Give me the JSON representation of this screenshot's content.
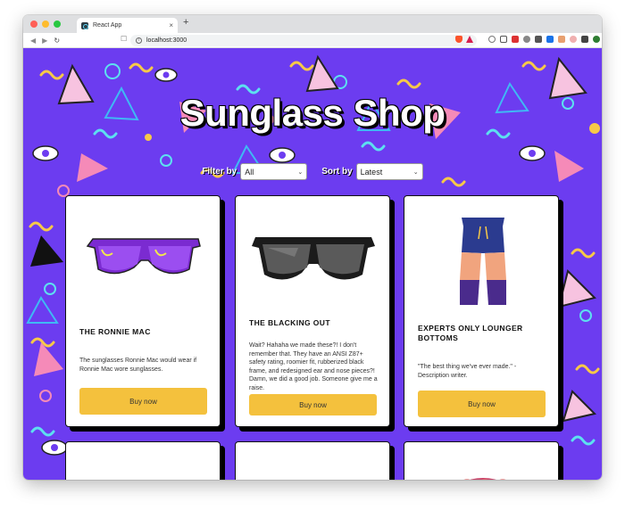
{
  "browser": {
    "tab_title": "React App",
    "tab_close": "×",
    "new_tab": "+",
    "url": "localhost:3000",
    "nav": {
      "back": "◀",
      "forward": "▶",
      "reload": "↻"
    },
    "traffic_lights": [
      "#ff5f57",
      "#febc2e",
      "#28c840"
    ]
  },
  "page": {
    "title": "Sunglass Shop",
    "filter": {
      "label": "Filter by",
      "value": "All"
    },
    "sort": {
      "label": "Sort by",
      "value": "Latest"
    }
  },
  "products": [
    {
      "name": "THE RONNIE MAC",
      "description": "The sunglasses Ronnie Mac would wear if Ronnie Mac wore sunglasses.",
      "button": "Buy now",
      "image_icon": "purple-shield-sunglasses"
    },
    {
      "name": "THE BLACKING OUT",
      "description": "Wait? Hahaha we made these?! I don't remember that. They have an ANSI Z87+ safety rating, roomier fit, rubberized black frame, and redesigned ear and nose pieces?! Damn, we did a good job. Someone give me a raise.",
      "button": "Buy now",
      "image_icon": "black-shield-sunglasses"
    },
    {
      "name": "EXPERTS ONLY LOUNGER BOTTOMS",
      "description": "\"The best thing we've ever made.\" - Description writer.",
      "button": "Buy now",
      "image_icon": "lounger-pants"
    }
  ],
  "colors": {
    "background": "#6c3cf0",
    "button": "#f4c13d",
    "card": "#ffffff"
  }
}
